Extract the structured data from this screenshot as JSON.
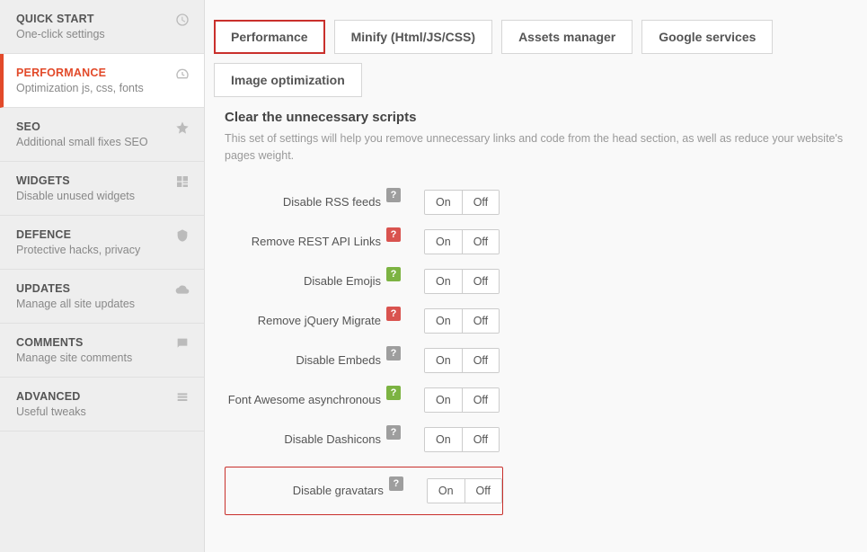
{
  "sidebar": [
    {
      "title": "QUICK START",
      "sub": "One-click settings",
      "icon": "clock",
      "active": false
    },
    {
      "title": "PERFORMANCE",
      "sub": "Optimization js, css, fonts",
      "icon": "gauge",
      "active": true
    },
    {
      "title": "SEO",
      "sub": "Additional small fixes SEO",
      "icon": "star",
      "active": false
    },
    {
      "title": "WIDGETS",
      "sub": "Disable unused widgets",
      "icon": "widgets",
      "active": false
    },
    {
      "title": "DEFENCE",
      "sub": "Protective hacks, privacy",
      "icon": "shield",
      "active": false
    },
    {
      "title": "UPDATES",
      "sub": "Manage all site updates",
      "icon": "cloud",
      "active": false
    },
    {
      "title": "COMMENTS",
      "sub": "Manage site comments",
      "icon": "comment",
      "active": false
    },
    {
      "title": "ADVANCED",
      "sub": "Useful tweaks",
      "icon": "list",
      "active": false
    }
  ],
  "tabs": [
    {
      "label": "Performance",
      "active": true
    },
    {
      "label": "Minify (Html/JS/CSS)",
      "active": false
    },
    {
      "label": "Assets manager",
      "active": false
    },
    {
      "label": "Google services",
      "active": false
    },
    {
      "label": "Image optimization",
      "active": false
    }
  ],
  "section": {
    "heading": "Clear the unnecessary scripts",
    "desc": "This set of settings will help you remove unnecessary links and code from the head section, as well as reduce your website's pages weight."
  },
  "toggle": {
    "on": "On",
    "off": "Off"
  },
  "settings": [
    {
      "label": "Disable RSS feeds",
      "help": "gray",
      "highlight": false
    },
    {
      "label": "Remove REST API Links",
      "help": "red",
      "highlight": false
    },
    {
      "label": "Disable Emojis",
      "help": "green",
      "highlight": false
    },
    {
      "label": "Remove jQuery Migrate",
      "help": "red",
      "highlight": false
    },
    {
      "label": "Disable Embeds",
      "help": "gray",
      "highlight": false
    },
    {
      "label": "Font Awesome asynchronous",
      "help": "green",
      "highlight": false
    },
    {
      "label": "Disable Dashicons",
      "help": "gray",
      "highlight": false
    },
    {
      "label": "Disable gravatars",
      "help": "gray",
      "highlight": true
    }
  ]
}
